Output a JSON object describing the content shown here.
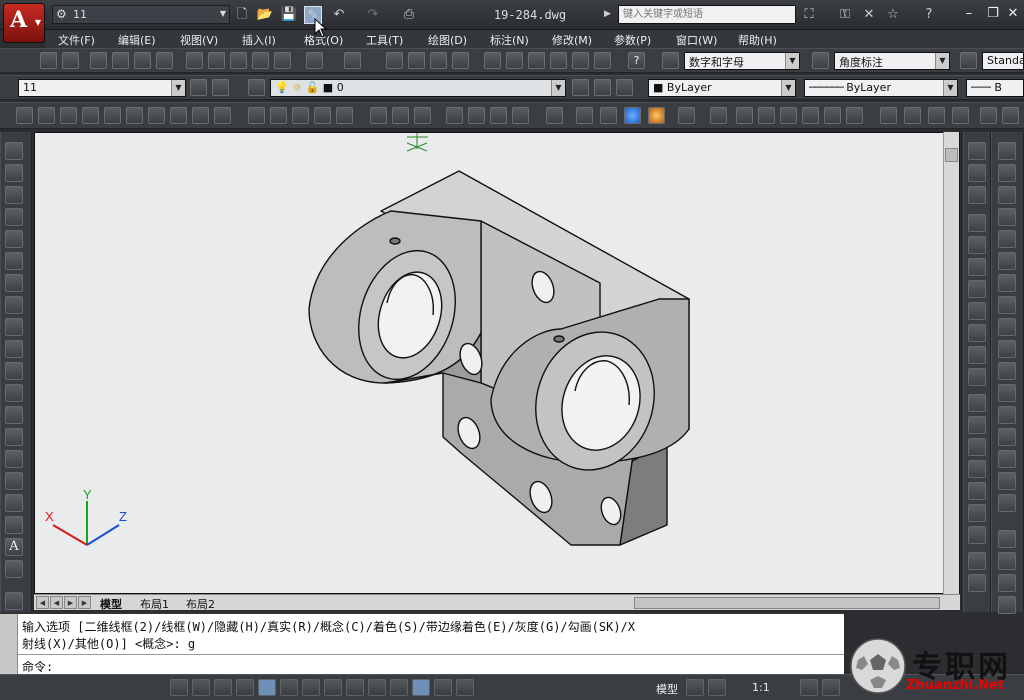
{
  "title_bar": {
    "workspace_value": "11",
    "document_title": "19-284.dwg",
    "search_placeholder": "键入关键字或短语",
    "help_label": "?"
  },
  "menu": [
    "文件(F)",
    "编辑(E)",
    "视图(V)",
    "插入(I)",
    "格式(O)",
    "工具(T)",
    "绘图(D)",
    "标注(N)",
    "修改(M)",
    "参数(P)",
    "窗口(W)",
    "帮助(H)"
  ],
  "styles_toolbar": {
    "text_style": "数字和字母",
    "dim_style": "角度标注",
    "table_style": "Standa"
  },
  "layers_toolbar": {
    "workspace_combo": "11",
    "layer_value": "0"
  },
  "properties_toolbar": {
    "color": "ByLayer",
    "linetype": "ByLayer",
    "lineweight": "B"
  },
  "ucs": {
    "x": "X",
    "y": "Y",
    "z": "Z"
  },
  "layout_tabs": [
    "模型",
    "布局1",
    "布局2"
  ],
  "command": {
    "line1": "输入选项 [二维线框(2)/线框(W)/隐藏(H)/真实(R)/概念(C)/着色(S)/带边缘着色(E)/灰度(G)/勾画(SK)/X",
    "line2": "射线(X)/其他(O)] <概念>: g",
    "prompt": "命令:"
  },
  "status_bar": {
    "model_label": "模型",
    "scale": "1:1"
  },
  "watermark": {
    "cn": "专职网",
    "en": "Zhuanzhi.Net"
  },
  "colors": {
    "accent": "#c62a22",
    "canvas_bg": "#e9ebec",
    "part_face": "#a8a8a8"
  }
}
